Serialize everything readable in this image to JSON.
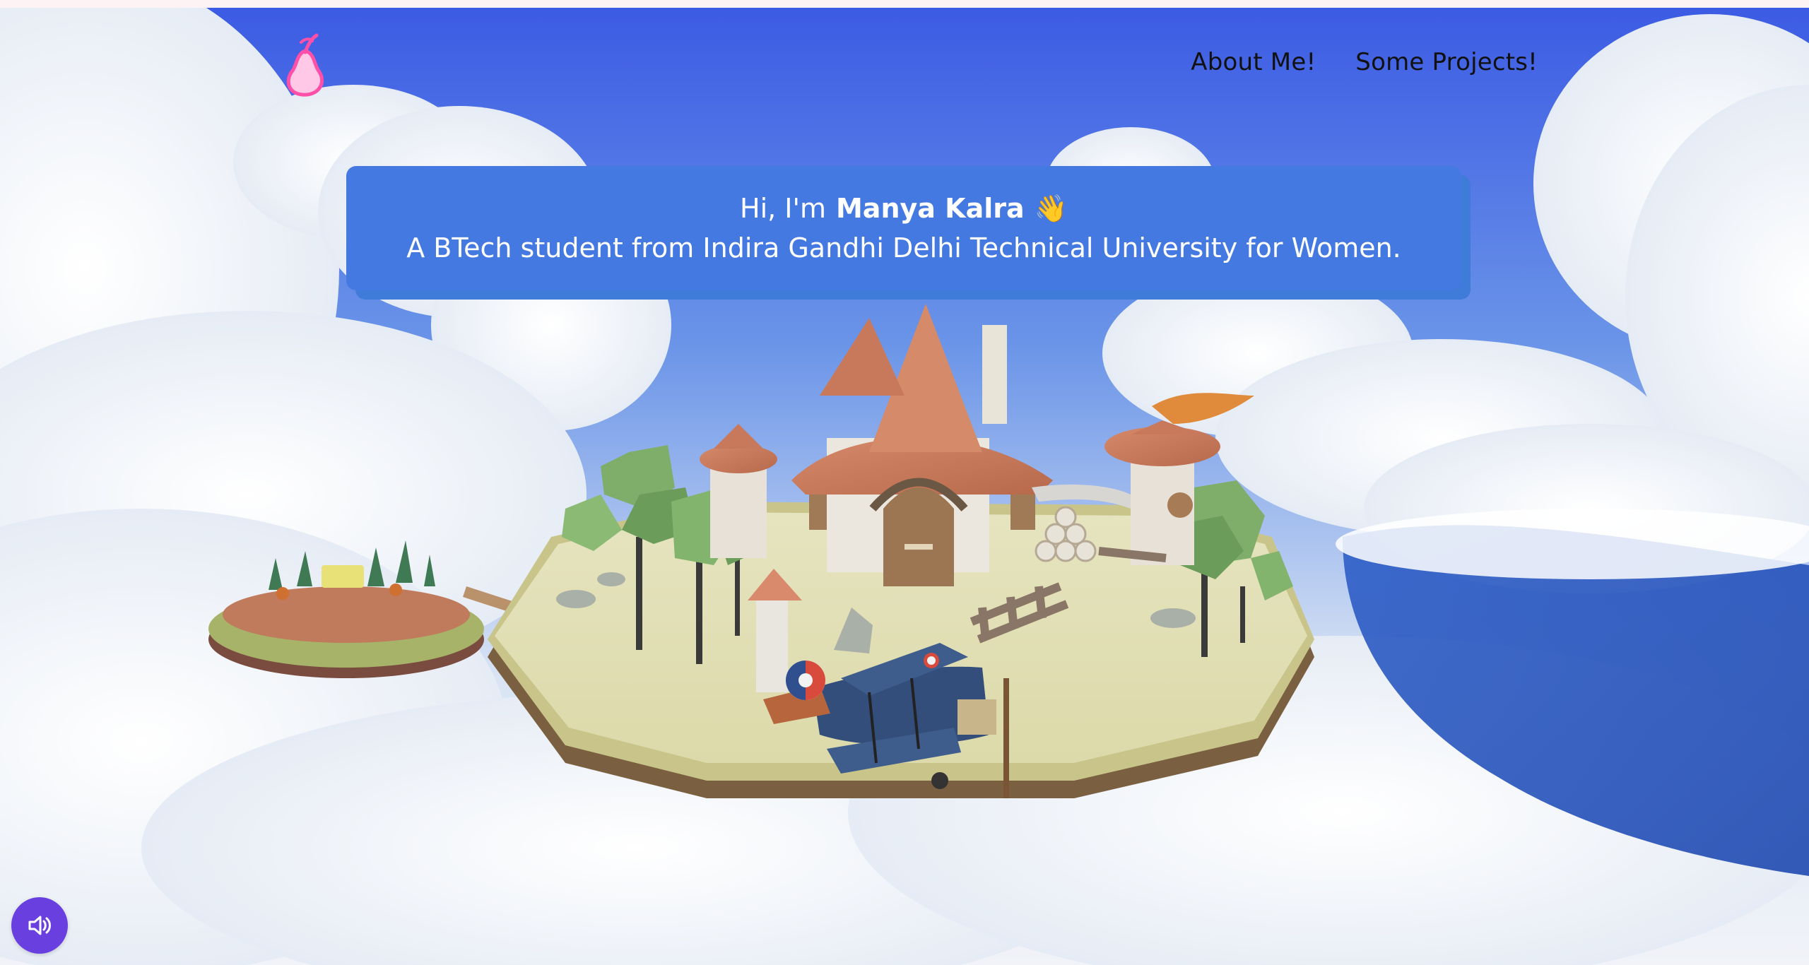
{
  "nav": {
    "logo_icon": "pear-icon",
    "links": [
      {
        "label": "About Me!"
      },
      {
        "label": "Some Projects!"
      }
    ]
  },
  "intro": {
    "greeting_prefix": "Hi, I'm",
    "name": "Manya Kalra",
    "wave_emoji": "👋",
    "subtitle": "A BTech student from Indira Gandhi Delhi Technical University for Women."
  },
  "sound_button": {
    "icon": "speaker-icon"
  },
  "colors": {
    "card": "#4479e2",
    "sound_button": "#6a3fe0",
    "logo": "#ff4fa8",
    "sky_top": "#3c5be4"
  }
}
